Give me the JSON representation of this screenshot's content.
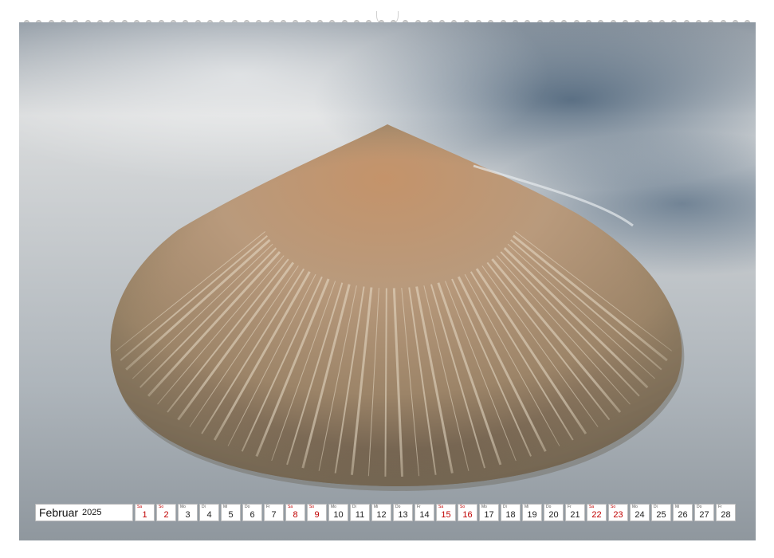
{
  "photo": {
    "subject": "cone-shaped sand dune surrounded by water"
  },
  "calendar": {
    "month": "Februar",
    "year": "2025",
    "weekend_color": "#c00000",
    "days": [
      {
        "abbr": "Sa",
        "num": "1",
        "weekend": true
      },
      {
        "abbr": "So",
        "num": "2",
        "weekend": true
      },
      {
        "abbr": "Mo",
        "num": "3",
        "weekend": false
      },
      {
        "abbr": "Di",
        "num": "4",
        "weekend": false
      },
      {
        "abbr": "Mi",
        "num": "5",
        "weekend": false
      },
      {
        "abbr": "Do",
        "num": "6",
        "weekend": false
      },
      {
        "abbr": "Fr",
        "num": "7",
        "weekend": false
      },
      {
        "abbr": "Sa",
        "num": "8",
        "weekend": true
      },
      {
        "abbr": "So",
        "num": "9",
        "weekend": true
      },
      {
        "abbr": "Mo",
        "num": "10",
        "weekend": false
      },
      {
        "abbr": "Di",
        "num": "11",
        "weekend": false
      },
      {
        "abbr": "Mi",
        "num": "12",
        "weekend": false
      },
      {
        "abbr": "Do",
        "num": "13",
        "weekend": false
      },
      {
        "abbr": "Fr",
        "num": "14",
        "weekend": false
      },
      {
        "abbr": "Sa",
        "num": "15",
        "weekend": true
      },
      {
        "abbr": "So",
        "num": "16",
        "weekend": true
      },
      {
        "abbr": "Mo",
        "num": "17",
        "weekend": false
      },
      {
        "abbr": "Di",
        "num": "18",
        "weekend": false
      },
      {
        "abbr": "Mi",
        "num": "19",
        "weekend": false
      },
      {
        "abbr": "Do",
        "num": "20",
        "weekend": false
      },
      {
        "abbr": "Fr",
        "num": "21",
        "weekend": false
      },
      {
        "abbr": "Sa",
        "num": "22",
        "weekend": true
      },
      {
        "abbr": "So",
        "num": "23",
        "weekend": true
      },
      {
        "abbr": "Mo",
        "num": "24",
        "weekend": false
      },
      {
        "abbr": "Di",
        "num": "25",
        "weekend": false
      },
      {
        "abbr": "Mi",
        "num": "26",
        "weekend": false
      },
      {
        "abbr": "Do",
        "num": "27",
        "weekend": false
      },
      {
        "abbr": "Fr",
        "num": "28",
        "weekend": false
      }
    ]
  }
}
